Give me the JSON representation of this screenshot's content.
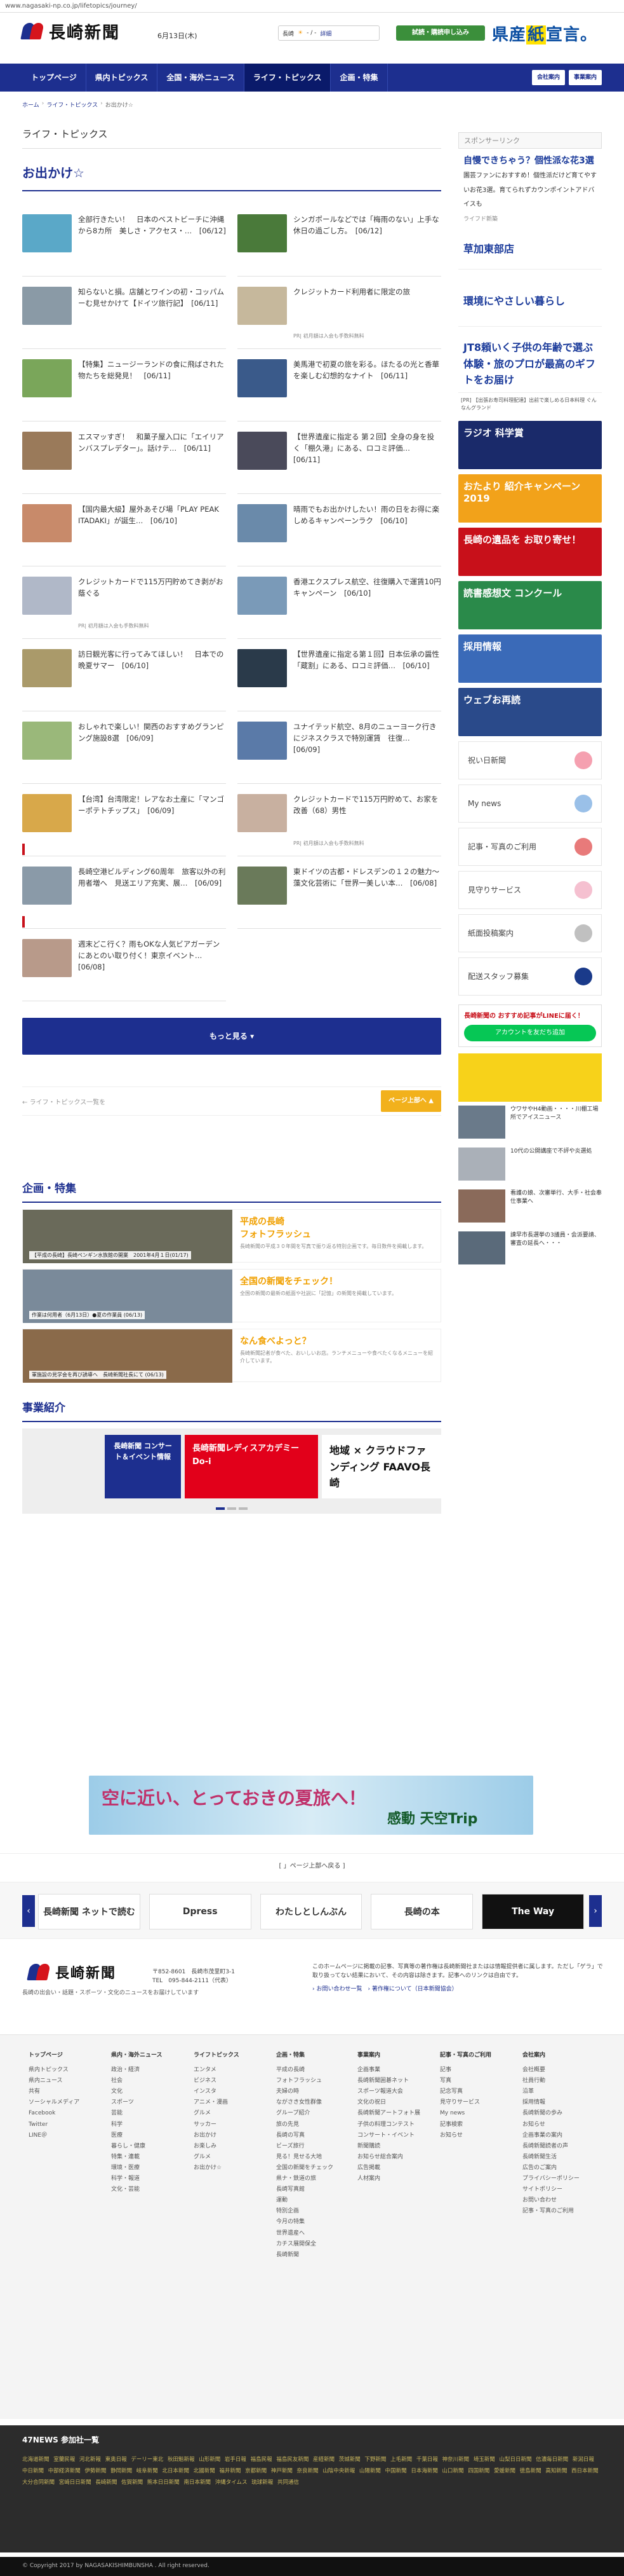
{
  "url": "www.nagasaki-np.co.jp/lifetopics/journey/",
  "header": {
    "logo_text": "長崎新聞",
    "date": "6月13日(木)",
    "weather": {
      "city": "長崎",
      "temp": "- / -",
      "link": "詳細"
    },
    "trial_button": "試読・購読申し込み",
    "ad_text_1": "県産",
    "ad_text_2": "紙",
    "ad_text_3": "宣言。"
  },
  "nav": {
    "items": [
      "トップページ",
      "県内トピックス",
      "全国・海外ニュース",
      "ライフ・トピックス",
      "企画・特集"
    ],
    "right": [
      "会社案内",
      "事業案内"
    ]
  },
  "breadcrumb": [
    "ホーム",
    "ライフ・トピックス",
    "お出かけ☆"
  ],
  "main": {
    "section_label": "ライフ・トピックス",
    "page_title": "お出かけ☆",
    "articles": [
      {
        "title": "全部行きたい！　日本のベストビーチに沖縄から8カ所　美しさ・アクセス・…",
        "date": "[06/12]",
        "sponsor": ""
      },
      {
        "title": "シンガポールなどでは「梅雨のない」上手な休日の過ごし方。",
        "date": "[06/12]",
        "sponsor": ""
      },
      {
        "title": "知らないと損。店舗とワインの初・コッパムーむ見せかけて【ドイツ旅行記】",
        "date": "[06/11]",
        "sponsor": ""
      },
      {
        "title": "クレジットカード利用者に限定の旅",
        "date": "",
        "sponsor": "PR| 初月額は入会も手数料無料"
      },
      {
        "title": "【特集】ニュージーランドの食に飛ばされた物たちを総発見！",
        "date": "[06/11]",
        "sponsor": ""
      },
      {
        "title": "美馬港で初夏の旅を彩る。ほたるの光と香華を楽しむ幻想的なナイト",
        "date": "[06/11]",
        "sponsor": ""
      },
      {
        "title": "エスマッすぎ！　和菓子屋入口に「エイリアンバスプレデター」。話けテ…",
        "date": "[06/11]",
        "sponsor": ""
      },
      {
        "title": "【世界遺産に指定る 第２回】全身の身を投く「棚久港」にある、ロコミ評価…",
        "date": "[06/11]",
        "sponsor": ""
      },
      {
        "title": "【国内最大級】屋外あそび場「PLAY PEAK ITADAKI」が誕生…",
        "date": "[06/10]",
        "sponsor": ""
      },
      {
        "title": "晴雨でもお出かけしたい！雨の日をお得に楽しめるキャンペーンラク",
        "date": "[06/10]",
        "sponsor": ""
      },
      {
        "title": "クレジットカードで115万円貯めてき剥がお蔭ぐる",
        "date": "",
        "sponsor": "PR| 初月額は入会も手数料無料"
      },
      {
        "title": "香港エクスプレス航空、往復購入で運賃10円キャンペーン",
        "date": "[06/10]",
        "sponsor": ""
      },
      {
        "title": "訪日観光客に行ってみてほしい！　日本での晩夏サマー",
        "date": "[06/10]",
        "sponsor": ""
      },
      {
        "title": "【世界遺産に指定る第１回】日本伝承の醤性「蔵割」にある、ロコミ評価…",
        "date": "[06/10]",
        "sponsor": ""
      },
      {
        "title": "おしゃれで楽しい！関西のおすすめグランピング施設8選",
        "date": "[06/09]",
        "sponsor": ""
      },
      {
        "title": "ユナイテッド航空、8月のニューヨーク行きにジネスクラスで特別運賃　往復…",
        "date": "[06/09]",
        "sponsor": ""
      },
      {
        "title": "【台湾】台湾限定！レアなお土産に「マンゴーポテトチップス」",
        "date": "[06/09]",
        "sponsor": ""
      },
      {
        "title": "クレジットカードで115万円貯めて、お家を改善（68）男性",
        "date": "",
        "sponsor": "PR| 初月額は入会も手数料無料"
      },
      {
        "title": "長崎空港ビルディング60周年　旅客以外の利用者増へ　見送エリア充実、展…",
        "date": "[06/09]",
        "sponsor": ""
      },
      {
        "title": "東ドイツの古都・ドレスデンの１２の魅力～藻文化芸術に「世界一美しい本…",
        "date": "[06/08]",
        "sponsor": ""
      },
      {
        "title": "週末どこ行く？雨もOKな人気ビアガーデンにあとのい取り付く！東京イベント…",
        "date": "[06/08]",
        "sponsor": ""
      }
    ],
    "more_button": "もっと見る ▾",
    "pager_prev": "ライフ・トピックス一覧を",
    "pager_next": "ページ上部へ",
    "kikaku_title": "企画・特集",
    "kikaku": [
      {
        "caption": "【平成の長崎】長崎ペンギン水族館の開業　2001年4月１日(01/17)",
        "name": "平成の長崎\nフォトフラッシュ",
        "desc": "長崎新聞の平成３０年間を写真で振り返る特別企画です。毎日数件を掲載します。"
      },
      {
        "caption": "作業は何用者（6月13日）●夏の作業員 (06/13)",
        "name": "全国の新聞をチェック！",
        "desc": "全国の新聞の最新の紙面や社説に「記憶」の新聞を掲載しています。"
      },
      {
        "caption": "軍施設の見学会を再び誘導へ　長崎新聞社長にて (06/13)",
        "name": "なん食べよっと？",
        "desc": "長崎新聞記者が食べた、おいしいお店。ランチメニューや食べたくなるメニューを紹介しています。"
      }
    ],
    "jigyo_title": "事業紹介",
    "jigyo_banners": [
      "長崎新聞 コンサート＆イベント情報",
      "長崎新聞レディスアカデミー Do-i",
      "地域 × クラウドファンディング FAAVO長崎"
    ]
  },
  "sidebar": {
    "sponsor_head": "スポンサーリンク",
    "ad_headline": "自慢できちゃう？個性派な花3選",
    "ad_sub": "園芸ファンにおすすめ！個性派だけど育てやすいお花3選。育てられずカウンポイントアドバイスも",
    "ad_source": "ライフド新築",
    "blue_links": [
      "草加東部店",
      "環境にやさしい暮らし",
      "JT8頼いく子供の年齢で選ぶ体験・旅のプロが最高のギフトをお届け"
    ],
    "pr_line": "[PR] 【出張お寿司料理配達】出前で楽しめる日本料理 ぐんなんグランド",
    "banners": [
      "ラジオ 科学賞",
      "おたより 紹介キャンペーン 2019",
      "長崎の遺品を お取り寄せ！",
      "読書感想文 コンクール",
      "採用情報",
      "ウェブお再読"
    ],
    "links": [
      "祝い日新聞",
      "My news",
      "記事・写真のご利用",
      "見守りサービス",
      "紙面投稿案内",
      "配送スタッフ募集"
    ],
    "line_head": "長崎新聞の おすすめ記事がLINEに届く！",
    "line_button": "アカウントを友だち追加",
    "news": [
      "ウワサやH4動画・・・・川棚工場所でアイスニュース",
      "10代の公開講座で不評や炎選処",
      "看護の娘、次審単行、大手・社会奉仕事業へ",
      "諫早市長選挙の3議員・会派要請、審査の延長へ・・・"
    ]
  },
  "ad_wide": {
    "text1": "空に近い、とっておきの夏旅へ！",
    "text2": "感動 天空Trip"
  },
  "pagetop": "[ 」ページ上部へ戻る ]",
  "logo_band": [
    "長崎新聞 ネットで読む",
    "Dpress",
    "わたしとしんぶん",
    "長崎の本",
    "The Way"
  ],
  "footer": {
    "logo": "長崎新聞",
    "addr_1": "〒852-8601　長崎市茂里町3-1",
    "addr_2": "TEL　095-844-2111（代表）",
    "tagline": "長崎の出会い・話題・スポーツ・文化のニュースをお届けしています",
    "note": "このホームページに掲載の記事、写真等の著作権は長崎新聞社またはは情報提供者に属します。ただし「ゲラ」で取り扱ってない結果において、その内容は除きます。記事へのリンクは自由です。",
    "note_links": "› お問い合わせ一覧　› 著作権について（日本新聞協会）"
  },
  "sitemap": [
    {
      "head": "トップページ",
      "items": [
        "県内トピックス",
        "県内ニュース",
        "共有",
        "ソーシャルメディア",
        "Facebook",
        "Twitter",
        "LINE＠"
      ]
    },
    {
      "head": "県内・海外ニュース",
      "items": [
        "政治・経済",
        "社会",
        "文化",
        "スポーツ",
        "芸能",
        "科学",
        "医療",
        "暮らし・健康",
        "特集・連載",
        "環境・医療",
        "科学・報道",
        "文化・芸能"
      ]
    },
    {
      "head": "ライフトピックス",
      "items": [
        "エンタメ",
        "ビジネス",
        "インスタ",
        "アニメ・漫画",
        "グルメ",
        "サッカー",
        "お出かけ",
        "お楽しみ",
        "グルメ",
        "お出かけ☆"
      ]
    },
    {
      "head": "企画・特集",
      "items": [
        "平成の長崎",
        "フォトフラッシュ",
        "夫婦の時",
        "ながさき女性群像",
        "グループ紹介",
        "旅の先見",
        "長崎の写真",
        "ビーズ旅行",
        "見る！見せる大地",
        "全国の新聞をチェック",
        "県ナ・鉄道の旅",
        "長崎写真館",
        "運動",
        "特別企画",
        "今月の特集",
        "世界遺産へ",
        "カチス展開保全",
        "長崎新聞"
      ]
    },
    {
      "head": "事業案内",
      "items": [
        "企画事業",
        "長崎新聞囲碁ネット",
        "スポーツ報道大会",
        "文化の祝日",
        "長崎新聞アートフォト展",
        "子供の料理コンテスト",
        "コンサート・イベント",
        "新聞購読",
        "お知らせ総合案内",
        "広告掲載",
        "人材案内"
      ]
    },
    {
      "head": "記事・写真のご利用",
      "items": [
        "記事",
        "写真",
        "記念写真",
        "見守りサービス",
        "My news",
        "記事検索",
        "お知らせ"
      ]
    },
    {
      "head": "会社案内",
      "items": [
        "会社概要",
        "社員行動",
        "沿革",
        "採用情報",
        "長崎新聞の歩み",
        "お知らせ",
        "企画事業の案内",
        "長崎新聞読者の声",
        "長崎新聞生活",
        "広告のご案内",
        "プライバシーポリシー",
        "サイトポリシー",
        "お問い合わせ",
        "記事・写真のご利用"
      ]
    }
  ],
  "news47": {
    "title": "47NEWS 参加社一覧",
    "links": "北海道新聞 室蘭民報 河北新報 東奥日報 デーリー東北 秋田魁新報 山形新聞 岩手日報 福島民報 福島民友新聞 産経新聞 茨城新聞 下野新聞 上毛新聞 千葉日報 神奈川新聞 埼玉新聞 山梨日日新聞 信濃毎日新聞 新潟日報 中日新聞 中部経済新聞 伊勢新聞 静岡新聞 岐阜新聞 北日本新聞 北國新聞 福井新聞 京都新聞 神戸新聞 奈良新聞 山陰中央新報 山陽新聞 中国新聞 日本海新聞 山口新聞 四国新聞 愛媛新聞 徳島新聞 高知新聞 西日本新聞 大分合同新聞 宮崎日日新聞 長崎新聞 佐賀新聞 熊本日日新聞 南日本新聞 沖縄タイムス 琉球新報 共同通信"
  },
  "copyright": "© Copyright 2017 by NAGASAKISHIMBUNSHA . All right reserved."
}
